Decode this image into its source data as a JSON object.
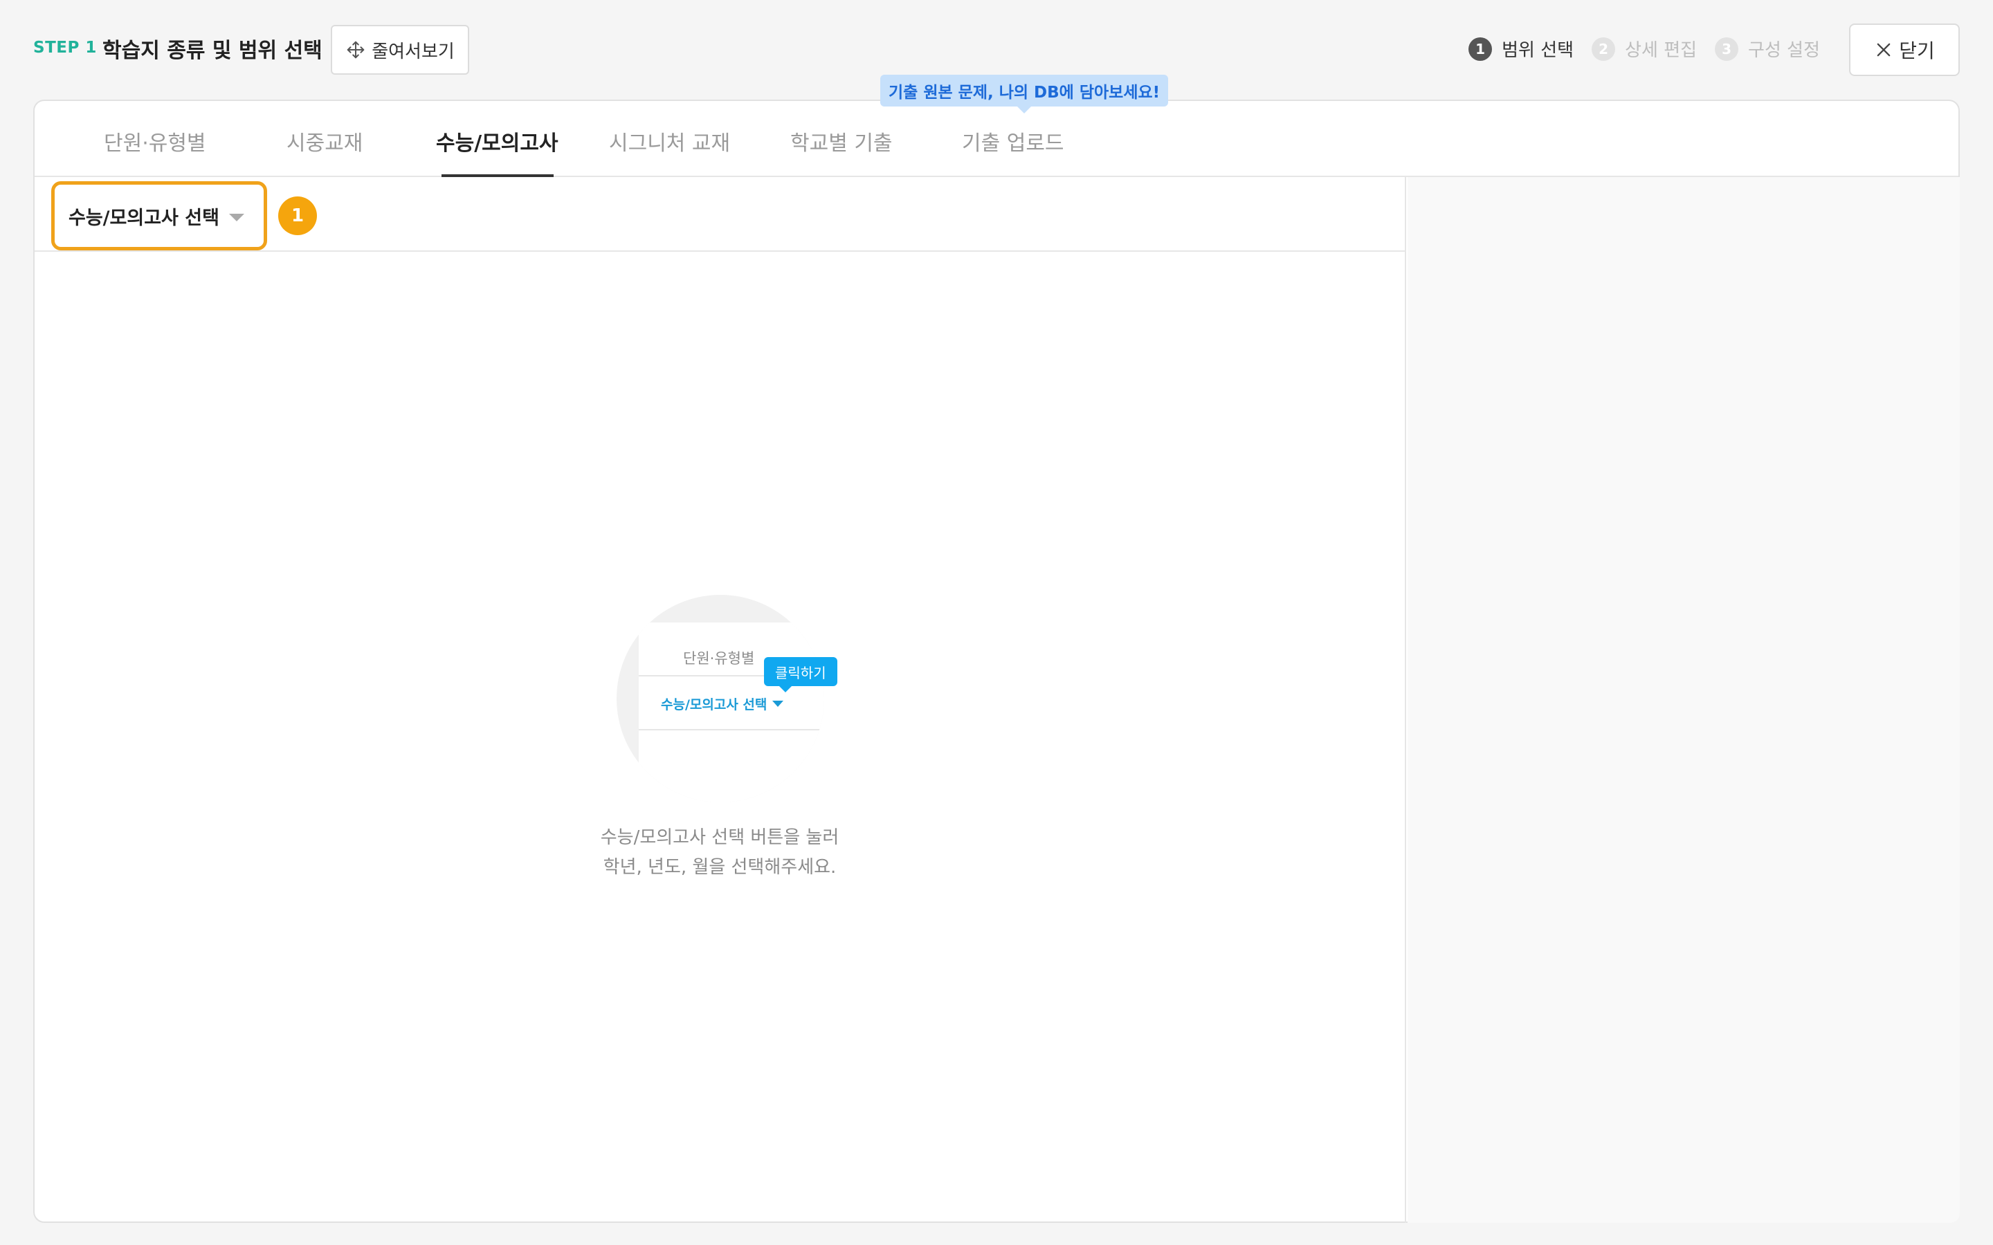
{
  "header": {
    "step_tag": "STEP 1",
    "title": "학습지 종류 및 범위 선택",
    "preview_label": "줄여서보기",
    "close_label": "닫기",
    "steps": [
      {
        "num": "1",
        "label": "범위 선택",
        "state": "active"
      },
      {
        "num": "2",
        "label": "상세 편집",
        "state": "inactive"
      },
      {
        "num": "3",
        "label": "구성 설정",
        "state": "inactive"
      }
    ]
  },
  "tabs": {
    "items": [
      {
        "label": "단원·유형별"
      },
      {
        "label": "시중교재"
      },
      {
        "label": "수능/모의고사"
      },
      {
        "label": "시그니처 교재"
      },
      {
        "label": "학교별 기출"
      },
      {
        "label": "기출 업로드"
      }
    ],
    "active_index": 2,
    "tooltip": "기출 원본 문제, 나의 DB에 담아보세요!"
  },
  "filter": {
    "select_label": "수능/모의고사 선택",
    "badge": "1"
  },
  "illustration": {
    "tab_label": "단원·유형별",
    "select_label": "수능/모의고사 선택",
    "tip_label": "클릭하기"
  },
  "empty_state": {
    "line1": "수능/모의고사 선택 버튼을 눌러",
    "line2": "학년, 년도, 월을 선택해주세요."
  },
  "colors": {
    "step_tag": "#21b29a",
    "select_outline": "#f0a21a",
    "badge": "#f5a50d",
    "tooltip_bg": "#c6e0fb",
    "tooltip_text": "#1d6ad8",
    "illus_accent": "#10a8f0"
  }
}
